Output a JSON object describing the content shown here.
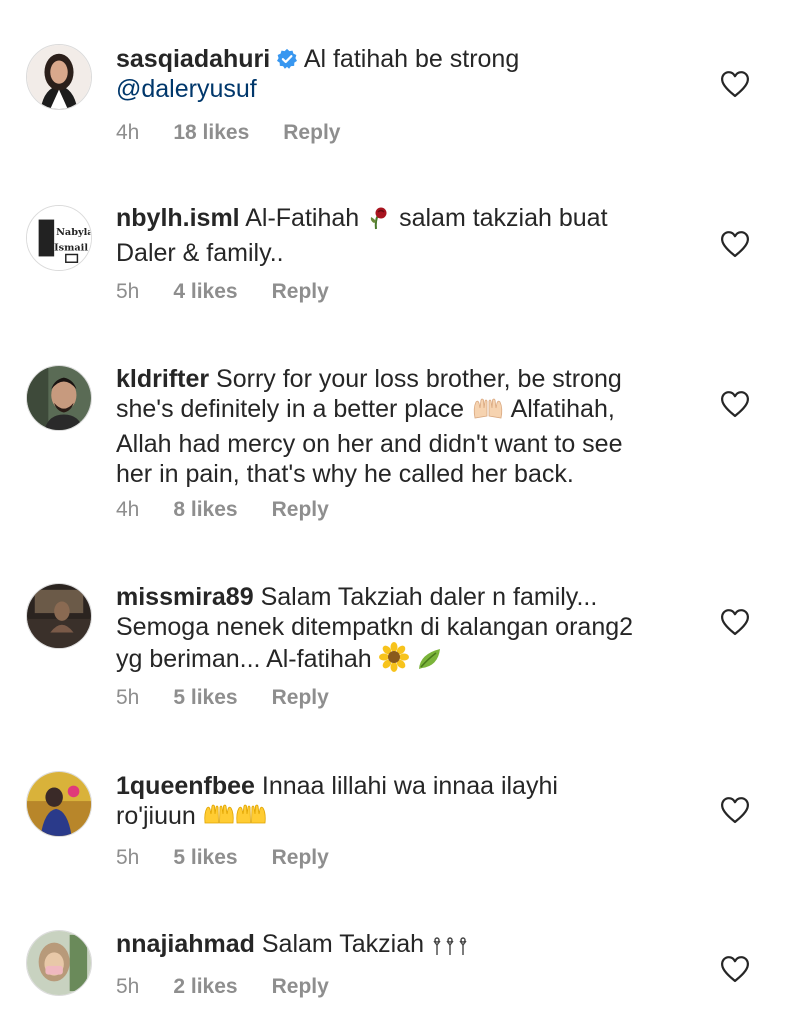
{
  "comments": [
    {
      "username": "sasqiadahuri",
      "verified": true,
      "text": "Al fatihah be strong",
      "mention": "@daleryusuf",
      "time": "4h",
      "likes": "18 likes",
      "reply": "Reply"
    },
    {
      "username": "nbylh.isml",
      "text_a": "Al-Fatihah",
      "text_b": "salam takziah buat",
      "text_c": "Daler & family..",
      "emoji": "wilted-rose",
      "time": "5h",
      "likes": "4 likes",
      "reply": "Reply",
      "avatar_text": [
        "Nabylah",
        "Ismail"
      ]
    },
    {
      "username": "kldrifter",
      "text_a": "Sorry for your loss brother, be strong",
      "text_b": "she's definitely in a better place",
      "text_c": "Alfatihah,",
      "text_d": "Allah had mercy on her and didn't want to see",
      "text_e": "her in pain, that's why he called her back.",
      "emoji": "raised-hands",
      "time": "4h",
      "likes": "8 likes",
      "reply": "Reply"
    },
    {
      "username": "missmira89",
      "text_a": "Salam Takziah daler n family...",
      "text_b": "Semoga nenek ditempatkn di kalangan orang2",
      "text_c": "yg beriman... Al-fatihah",
      "emoji": [
        "sunflower",
        "leaf"
      ],
      "time": "5h",
      "likes": "5 likes",
      "reply": "Reply"
    },
    {
      "username": "1queenfbee",
      "text_a": "Innaa lillahi wa innaa ilayhi",
      "text_b": "ro'jiuun",
      "emoji": [
        "open-hands",
        "open-hands"
      ],
      "time": "5h",
      "likes": "5 likes",
      "reply": "Reply"
    },
    {
      "username": "nnajiahmad",
      "text": "Salam Takziah",
      "emoji": "tiny-flowers",
      "time": "5h",
      "likes": "2 likes",
      "reply": "Reply"
    }
  ],
  "icons": {
    "heart": "heart-outline-icon",
    "verified": "verified-badge-icon"
  },
  "colors": {
    "text": "#262626",
    "meta": "#8e8e8e",
    "mention": "#00376b",
    "verified": "#3897f0"
  }
}
